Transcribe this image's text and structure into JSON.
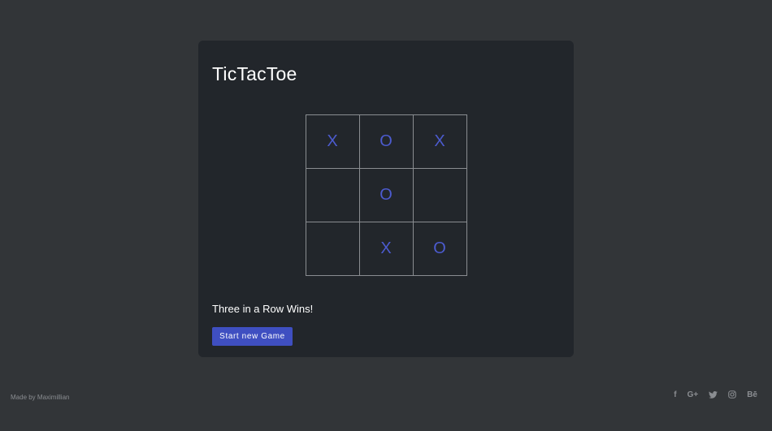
{
  "app": {
    "title": "TicTacToe"
  },
  "board": {
    "cells": [
      "X",
      "O",
      "X",
      "",
      "O",
      "",
      "",
      "X",
      "O"
    ]
  },
  "status": {
    "text": "Three in a Row Wins!"
  },
  "actions": {
    "new_game_label": "Start new Game"
  },
  "footer": {
    "credit": "Made by Maximillian",
    "social": [
      {
        "icon": "facebook-icon",
        "glyph": "f"
      },
      {
        "icon": "google-plus-icon",
        "glyph": "G+"
      },
      {
        "icon": "twitter-icon",
        "glyph": ""
      },
      {
        "icon": "instagram-icon",
        "glyph": ""
      },
      {
        "icon": "behance-icon",
        "glyph": "Bē"
      }
    ]
  },
  "colors": {
    "page_background": "#323538",
    "card_background": "#22262b",
    "accent": "#3f4fc1",
    "mark_color": "#4c5bcf",
    "grid_line": "#8a8d91"
  }
}
